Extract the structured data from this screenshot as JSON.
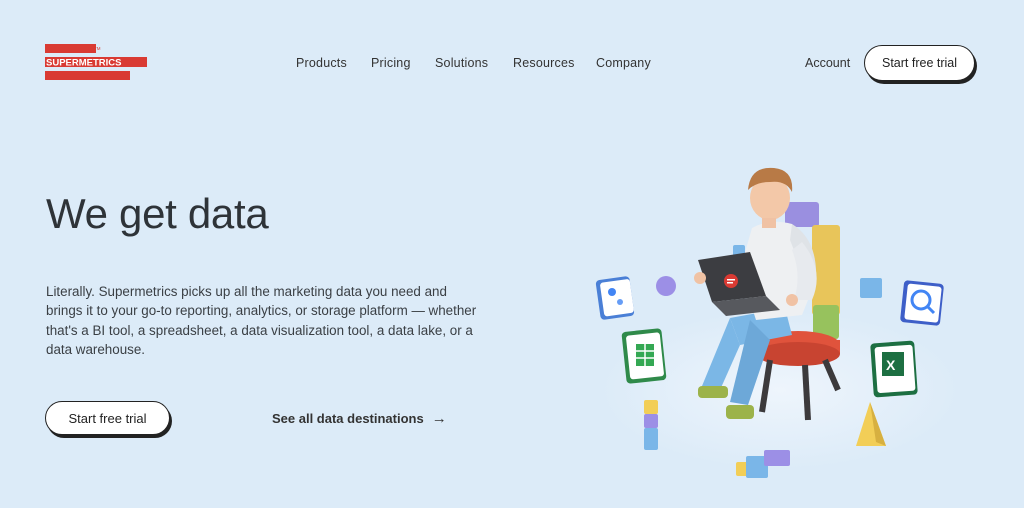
{
  "brand": {
    "logo_text": "SUPERMETRICS",
    "tm": "TM",
    "logo_color": "#d93a33"
  },
  "nav": {
    "items": [
      "Products",
      "Pricing",
      "Solutions",
      "Resources",
      "Company"
    ],
    "account": "Account",
    "cta": "Start free trial"
  },
  "hero": {
    "title": "We get data",
    "body": "Literally. Supermetrics picks up all the marketing data you need and brings it to your go-to reporting, analytics, or storage platform — whether that's a BI tool, a spreadsheet, a data visualization tool, a data lake, or a data warehouse.",
    "cta": "Start free trial",
    "link": "See all data destinations",
    "link_arrow": "→"
  },
  "colors": {
    "background": "#dcebf8",
    "text": "#2e3338",
    "accent": "#d93a33"
  },
  "illustration": {
    "icons": [
      "looker-studio-icon",
      "sheets-icon",
      "excel-icon",
      "bigquery-icon"
    ],
    "laptop_icon": "supermetrics-logo-icon"
  }
}
